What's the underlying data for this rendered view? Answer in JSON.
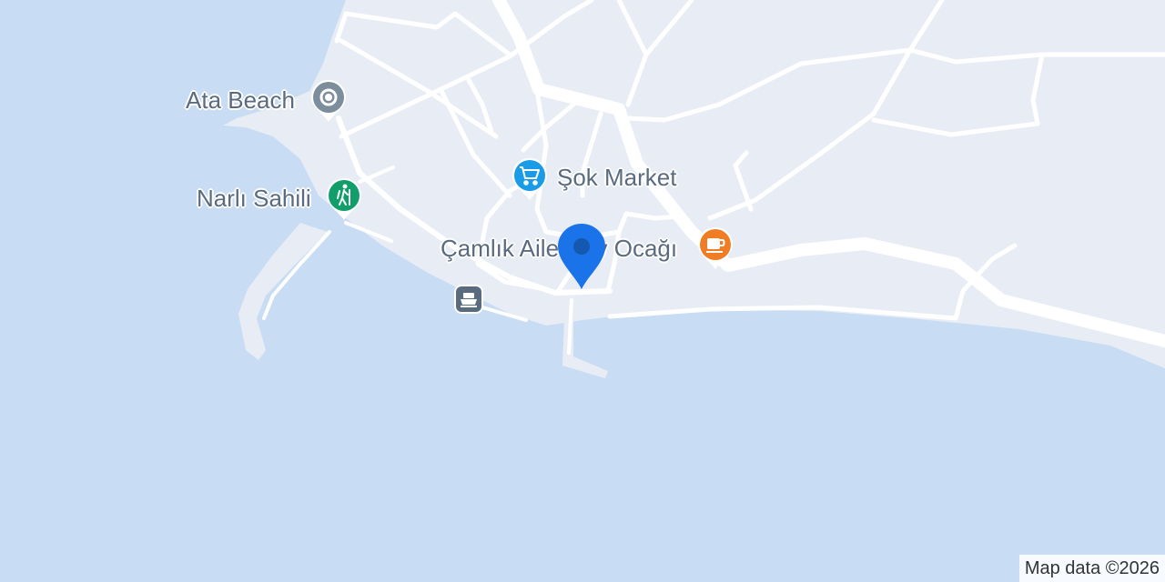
{
  "map": {
    "water_color": "#c8dcf3",
    "land_color": "#e8edf5",
    "road_color": "#ffffff",
    "attribution": "Map data ©2026"
  },
  "pois": {
    "ata_beach": {
      "label": "Ata Beach",
      "icon": "pin-icon",
      "color": "#7c8d9c"
    },
    "narli_sahili": {
      "label": "Narlı Sahili",
      "icon": "hiking-icon",
      "color": "#129e6a"
    },
    "sok_market": {
      "label": "Şok Market",
      "icon": "shopping-cart-icon",
      "color": "#1a9be8"
    },
    "camlik": {
      "label": "Çamlık Aile Çay Ocağı",
      "icon": "coffee-cup-icon",
      "color": "#f07c24"
    },
    "ferry": {
      "icon": "ferry-icon",
      "color": "#5a6b80"
    }
  },
  "selected_pin": {
    "icon": "location-pin-icon",
    "color": "#1a73e8"
  }
}
